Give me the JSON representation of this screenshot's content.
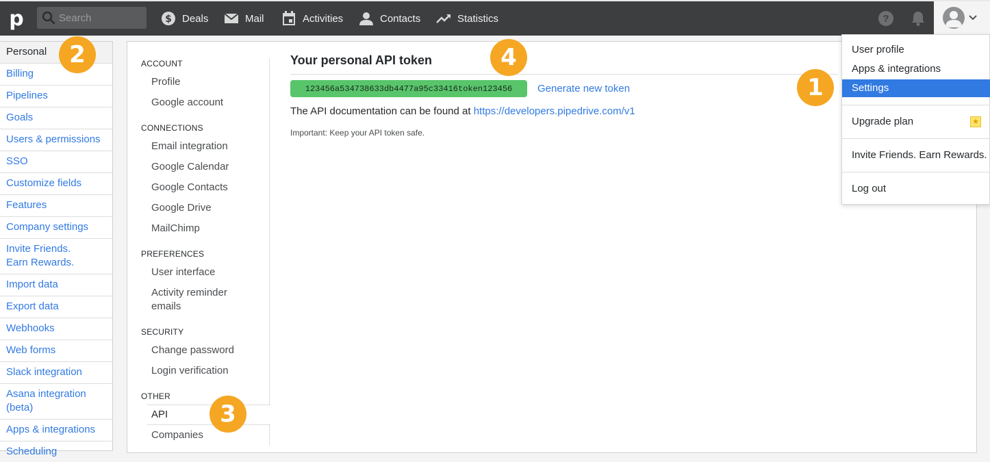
{
  "topbar": {
    "logo": "p",
    "search_placeholder": "Search",
    "nav": [
      {
        "label": "Deals",
        "icon": "dollar-icon"
      },
      {
        "label": "Mail",
        "icon": "mail-icon"
      },
      {
        "label": "Activities",
        "icon": "calendar-icon"
      },
      {
        "label": "Contacts",
        "icon": "person-icon"
      },
      {
        "label": "Statistics",
        "icon": "trend-icon"
      }
    ],
    "help_symbol": "?"
  },
  "left_menu": [
    {
      "label": "Personal",
      "active": true
    },
    {
      "label": "Billing"
    },
    {
      "label": "Pipelines"
    },
    {
      "label": "Goals"
    },
    {
      "label": "Users & permissions"
    },
    {
      "label": "SSO"
    },
    {
      "label": "Customize fields"
    },
    {
      "label": "Features"
    },
    {
      "label": "Company settings"
    },
    {
      "label": "Invite Friends.\nEarn Rewards."
    },
    {
      "label": "Import data"
    },
    {
      "label": "Export data"
    },
    {
      "label": "Webhooks"
    },
    {
      "label": "Web forms"
    },
    {
      "label": "Slack integration"
    },
    {
      "label": "Asana integration\n(beta)"
    },
    {
      "label": "Apps & integrations"
    },
    {
      "label": "Scheduling"
    }
  ],
  "subnav": {
    "account": "ACCOUNT",
    "profile": "Profile",
    "google_account": "Google account",
    "connections": "CONNECTIONS",
    "email_integration": "Email integration",
    "google_calendar": "Google Calendar",
    "google_contacts": "Google Contacts",
    "google_drive": "Google Drive",
    "mailchimp": "MailChimp",
    "preferences": "PREFERENCES",
    "user_interface": "User interface",
    "activity_reminder": "Activity reminder\nemails",
    "security": "SECURITY",
    "change_password": "Change password",
    "login_verification": "Login verification",
    "other": "OTHER",
    "api": "API",
    "companies": "Companies"
  },
  "content": {
    "title": "Your personal API token",
    "token": "123456a534738633db4477a95c33416token123456",
    "generate": "Generate new token",
    "doc_text": "The API documentation can be found at ",
    "doc_link": "https://developers.pipedrive.com/v1",
    "note": "Important: Keep your API token safe."
  },
  "dropdown": {
    "user_profile": "User profile",
    "apps": "Apps & integrations",
    "settings": "Settings",
    "upgrade": "Upgrade plan",
    "invite": "Invite Friends. Earn Rewards.",
    "logout": "Log out"
  },
  "badges": {
    "b1": "1",
    "b2": "2",
    "b3": "3",
    "b4": "4"
  },
  "colors": {
    "accent": "#317ae2",
    "topbar": "#3d3e40",
    "token": "#58c56b",
    "badge": "#f5a623"
  }
}
